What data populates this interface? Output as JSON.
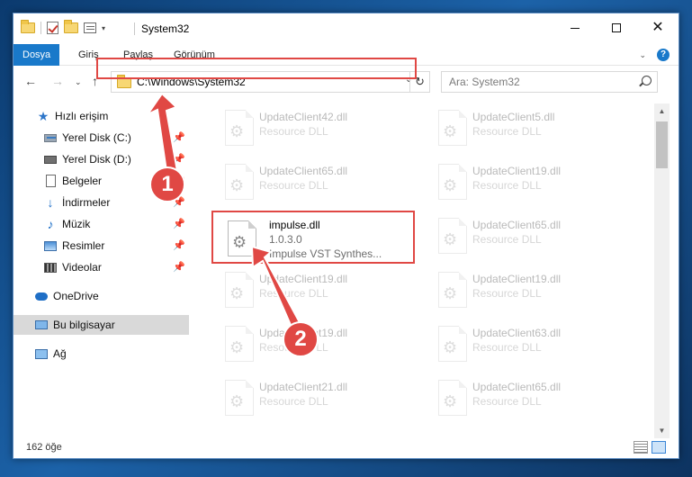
{
  "window": {
    "title": "System32"
  },
  "ribbon": {
    "tabs": [
      "Dosya",
      "Giriş",
      "Paylaş",
      "Görünüm"
    ]
  },
  "nav": {
    "address": "C:\\Windows\\System32",
    "search_placeholder": "Ara: System32"
  },
  "sidebar": {
    "items": [
      {
        "label": "Hızlı erişim"
      },
      {
        "label": "Yerel Disk (C:)"
      },
      {
        "label": "Yerel Disk (D:)"
      },
      {
        "label": "Belgeler"
      },
      {
        "label": "İndirmeler"
      },
      {
        "label": "Müzik"
      },
      {
        "label": "Resimler"
      },
      {
        "label": "Videolar"
      },
      {
        "label": "OneDrive"
      },
      {
        "label": "Bu bilgisayar"
      },
      {
        "label": "Ağ"
      }
    ]
  },
  "files": [
    {
      "name": "UpdateClient42.dll",
      "line1": "Resource DLL"
    },
    {
      "name": "UpdateClient5.dll",
      "line1": "Resource DLL"
    },
    {
      "name": "UpdateClient65.dll",
      "line1": "Resource DLL"
    },
    {
      "name": "UpdateClient19.dll",
      "line1": "Resource DLL"
    },
    {
      "name": "impulse.dll",
      "line1": "1.0.3.0",
      "line2": "Impulse VST Synthes..."
    },
    {
      "name": "UpdateClient65.dll",
      "line1": "Resource DLL"
    },
    {
      "name": "UpdateClient19.dll",
      "line1": "Resource DLL"
    },
    {
      "name": "UpdateClient19.dll",
      "line1": "Resource DLL"
    },
    {
      "name": "UpdateClient19.dll",
      "line1": "Resource DLL"
    },
    {
      "name": "UpdateClient63.dll",
      "line1": "Resource DLL"
    },
    {
      "name": "UpdateClient21.dll",
      "line1": "Resource DLL"
    },
    {
      "name": "UpdateClient65.dll",
      "line1": "Resource DLL"
    }
  ],
  "status": {
    "count": "162 öğe"
  },
  "callouts": {
    "step1": "1",
    "step2": "2"
  },
  "colors": {
    "accent": "#1979ca",
    "highlight": "#e04844"
  }
}
